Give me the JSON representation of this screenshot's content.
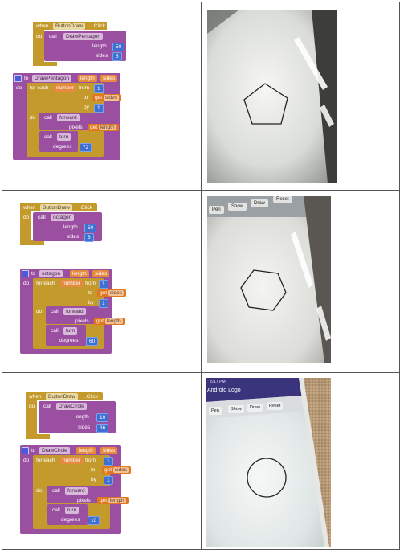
{
  "rows": [
    {
      "event": {
        "when": "when",
        "component": "ButtonDraw",
        "event": ".Click",
        "do": "do"
      },
      "call": {
        "call": "call",
        "proc": "DrawPentagon",
        "arg1_name": "length",
        "arg1_value": "50",
        "arg2_name": "sides",
        "arg2_value": "5"
      },
      "def": {
        "to": "to",
        "proc": "DrawPentagon",
        "param1": "length",
        "param2": "sides",
        "do": "do",
        "for_each": "for each",
        "var": "number",
        "from": "from",
        "from_value": "1",
        "to_lbl": "to",
        "get": "get",
        "get_to": "sides",
        "by": "by",
        "by_value": "1",
        "do2": "do",
        "call1": "call",
        "forward": "forward",
        "pixels": "pixels",
        "get2": "get",
        "get_pixels": "length",
        "call2": "call",
        "turn": "turn",
        "degrees": "degrees",
        "degrees_value": "72"
      },
      "shape": "pentagon"
    },
    {
      "event": {
        "when": "when",
        "component": "ButtonDraw",
        "event": ".Click",
        "do": "do"
      },
      "call": {
        "call": "call",
        "proc": "octagon",
        "arg1_name": "length",
        "arg1_value": "50",
        "arg2_name": "sides",
        "arg2_value": "6"
      },
      "def": {
        "to": "to",
        "proc": "octagon",
        "param1": "length",
        "param2": "sides",
        "do": "do",
        "for_each": "for each",
        "var": "number",
        "from": "from",
        "from_value": "1",
        "to_lbl": "to",
        "get": "get",
        "get_to": "sides",
        "by": "by",
        "by_value": "1",
        "do2": "do",
        "call1": "call",
        "forward": "forward",
        "pixels": "pixels",
        "get2": "get",
        "get_pixels": "length",
        "call2": "call",
        "turn": "turn",
        "degrees": "degrees",
        "degrees_value": "60"
      },
      "tabs": [
        "Pen",
        "Show",
        "Draw",
        "Reset"
      ],
      "shape": "hexagon"
    },
    {
      "event": {
        "when": "when",
        "component": "ButtonDraw",
        "event": ".Click",
        "do": "do"
      },
      "call": {
        "call": "call",
        "proc": "DrawCircle",
        "arg1_name": "length",
        "arg1_value": "10",
        "arg2_name": "sides",
        "arg2_value": "36"
      },
      "def": {
        "to": "to",
        "proc": "DrawCircle",
        "param1": "length",
        "param2": "sides",
        "do": "do",
        "for_each": "for each",
        "var": "number",
        "from": "from",
        "from_value": "1",
        "to_lbl": "to",
        "get": "get",
        "get_to": "sides",
        "by": "by",
        "by_value": "1",
        "do2": "do",
        "call1": "call",
        "forward": "forward",
        "pixels": "pixels",
        "get2": "get",
        "get_pixels": "length",
        "call2": "call",
        "turn": "turn",
        "degrees": "degrees",
        "degrees_value": "10"
      },
      "app_title": "Android Logo",
      "status": "5:17 PM",
      "tabs": [
        "Pen",
        "Show",
        "Draw",
        "Reset"
      ],
      "shape": "circle"
    }
  ],
  "colors": {
    "event": "#c49a2c",
    "procedure": "#9b4fa0",
    "control": "#c49a2c",
    "variable": "#e0771f",
    "number": "#3f6fd1",
    "grid": "#555555"
  }
}
